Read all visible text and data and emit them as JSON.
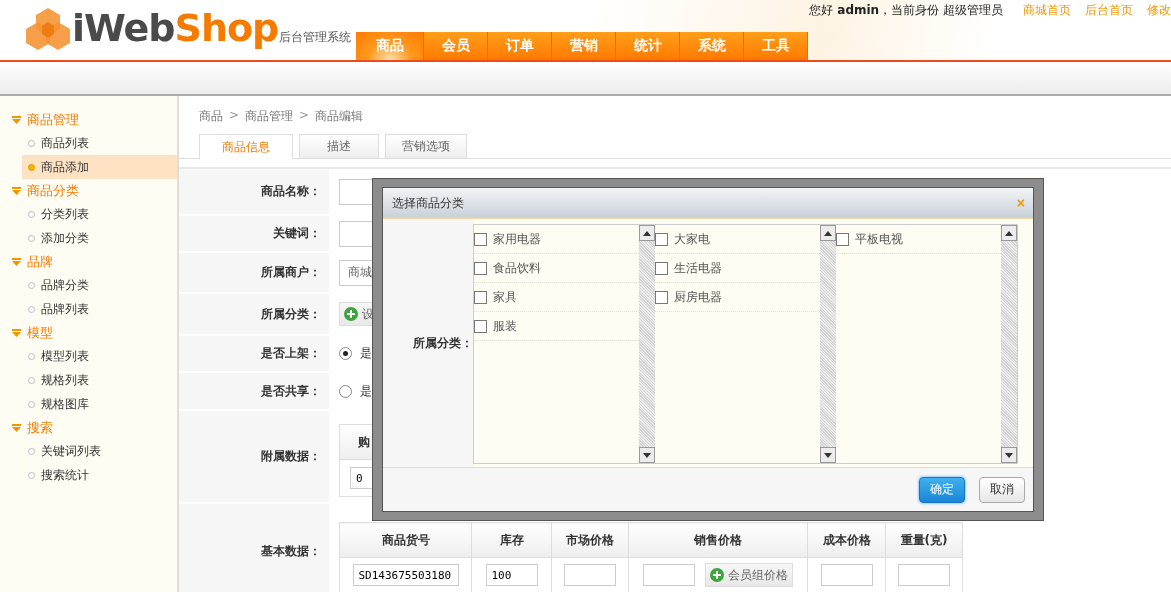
{
  "header": {
    "logo": {
      "brand_dark": "iWeb",
      "brand_accent": "Shop",
      "subtitle": "后台管理系统"
    },
    "greeting": "您好 **admin**，当前身份 超级管理员",
    "links": [
      "商城首页",
      "后台首页",
      "修改"
    ],
    "nav": [
      {
        "label": "商品",
        "selected": true
      },
      {
        "label": "会员",
        "selected": false
      },
      {
        "label": "订单",
        "selected": false
      },
      {
        "label": "营销",
        "selected": false
      },
      {
        "label": "统计",
        "selected": false
      },
      {
        "label": "系统",
        "selected": false
      },
      {
        "label": "工具",
        "selected": false
      }
    ]
  },
  "sidebar": {
    "groups": [
      {
        "title": "商品管理",
        "items": [
          {
            "label": "商品列表",
            "selected": false
          },
          {
            "label": "商品添加",
            "selected": true
          }
        ]
      },
      {
        "title": "商品分类",
        "items": [
          {
            "label": "分类列表",
            "selected": false
          },
          {
            "label": "添加分类",
            "selected": false
          }
        ]
      },
      {
        "title": "品牌",
        "items": [
          {
            "label": "品牌分类",
            "selected": false
          },
          {
            "label": "品牌列表",
            "selected": false
          }
        ]
      },
      {
        "title": "模型",
        "items": [
          {
            "label": "模型列表",
            "selected": false
          },
          {
            "label": "规格列表",
            "selected": false
          },
          {
            "label": "规格图库",
            "selected": false
          }
        ]
      },
      {
        "title": "搜索",
        "items": [
          {
            "label": "关键词列表",
            "selected": false
          },
          {
            "label": "搜索统计",
            "selected": false
          }
        ]
      }
    ]
  },
  "breadcrumb": {
    "items": [
      "商品",
      "商品管理",
      "商品编辑"
    ],
    "separators": [
      ">",
      ">"
    ]
  },
  "tabs": [
    {
      "label": "商品信息",
      "selected": true
    },
    {
      "label": "描述",
      "selected": false
    },
    {
      "label": "营销选项",
      "selected": false
    }
  ],
  "form": {
    "rows": [
      {
        "label": "商品名称：",
        "kind": "input"
      },
      {
        "label": "关键词：",
        "kind": "input"
      },
      {
        "label": "所属商户：",
        "kind": "select",
        "value": "商城"
      },
      {
        "label": "所属分类：",
        "kind": "button",
        "button": "设"
      },
      {
        "label": "是否上架：",
        "kind": "radio",
        "option": "是",
        "selected": true
      },
      {
        "label": "是否共享：",
        "kind": "radio",
        "option": "是",
        "selected": false
      },
      {
        "label": "附属数据：",
        "kind": "extra",
        "header": "购",
        "value": "0"
      },
      {
        "label": "基本数据：",
        "kind": "basic"
      }
    ]
  },
  "basic_table": {
    "columns": [
      "商品货号",
      "库存",
      "市场价格",
      "销售价格",
      "成本价格",
      "重量(克)"
    ],
    "row": {
      "sku": "SD143675503180",
      "stock": "100",
      "member_price_button": "会员组价格"
    }
  },
  "dialog": {
    "title": "选择商品分类",
    "close": "×",
    "label": "所属分类：",
    "columns": [
      [
        {
          "label": "家用电器",
          "checked": false
        },
        {
          "label": "食品饮料",
          "checked": false
        },
        {
          "label": "家具",
          "checked": false
        },
        {
          "label": "服装",
          "checked": false
        }
      ],
      [
        {
          "label": "大家电",
          "checked": false
        },
        {
          "label": "生活电器",
          "checked": false
        },
        {
          "label": "厨房电器",
          "checked": false
        }
      ],
      [
        {
          "label": "平板电视",
          "checked": false
        }
      ]
    ],
    "buttons": [
      {
        "label": "确定",
        "kind": "primary"
      },
      {
        "label": "取消",
        "kind": "secondary"
      }
    ]
  }
}
